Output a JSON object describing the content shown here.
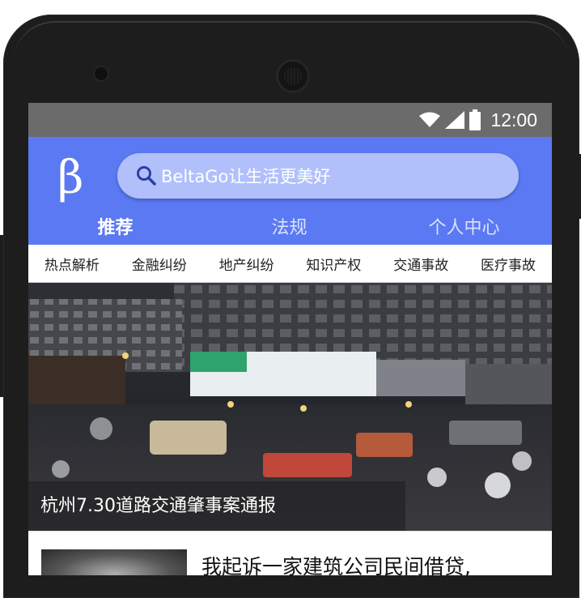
{
  "status_bar": {
    "time": "12:00",
    "icons": [
      "wifi-icon",
      "signal-icon",
      "battery-icon"
    ]
  },
  "header": {
    "logo_text": "β",
    "search_placeholder": "BeltaGo让生活更美好",
    "tabs": [
      {
        "label": "推荐",
        "active": true
      },
      {
        "label": "法规",
        "active": false
      },
      {
        "label": "个人中心",
        "active": false
      }
    ]
  },
  "categories": [
    "热点解析",
    "金融纠纷",
    "地产纠纷",
    "知识产权",
    "交通事故",
    "医疗事故"
  ],
  "hero": {
    "caption": "杭州7.30道路交通肇事案通报"
  },
  "news": [
    {
      "title": "我起诉一家建筑公司民间借贷,"
    }
  ],
  "colors": {
    "accent": "#5b79f2",
    "search_bg": "#b1c0fb",
    "status_bar": "#6b6b6b"
  }
}
